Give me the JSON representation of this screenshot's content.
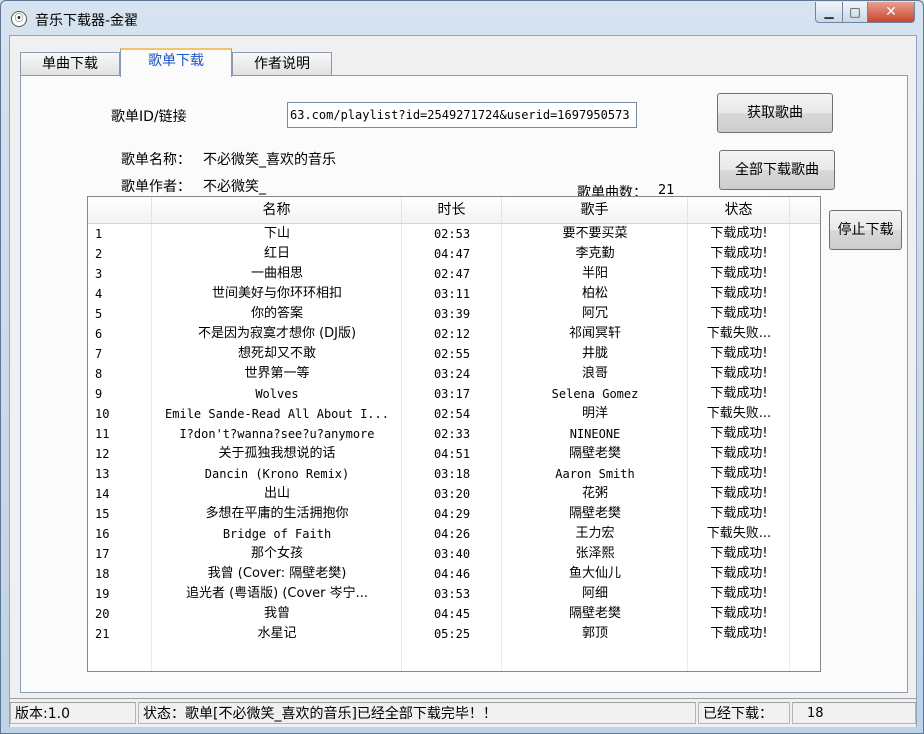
{
  "window": {
    "title": "音乐下载器-金翟",
    "minimize_label": "▁",
    "maximize_label": "□",
    "close_label": "✕"
  },
  "tabs": [
    {
      "label": "单曲下载",
      "active": false
    },
    {
      "label": "歌单下载",
      "active": true
    },
    {
      "label": "作者说明",
      "active": false
    }
  ],
  "playlist": {
    "id_label": "歌单ID/链接",
    "id_value": "63.com/playlist?id=2549271724&userid=1697950573",
    "fetch_button": "获取歌曲",
    "name_label": "歌单名称：",
    "name_value": "不必微笑_喜欢的音乐",
    "author_label": "歌单作者：",
    "author_value": "不必微笑_",
    "download_all_button": "全部下载歌曲",
    "count_label": "歌单曲数：",
    "count_value": "21",
    "stop_button": "停止下载"
  },
  "table": {
    "columns": [
      "名称",
      "时长",
      "歌手",
      "状态"
    ],
    "rows": [
      [
        "1",
        "下山",
        "02:53",
        "要不要买菜",
        "下载成功!"
      ],
      [
        "2",
        "红日",
        "04:47",
        "李克勤",
        "下载成功!"
      ],
      [
        "3",
        "一曲相思",
        "02:47",
        "半阳",
        "下载成功!"
      ],
      [
        "4",
        "世间美好与你环环相扣",
        "03:11",
        "柏松",
        "下载成功!"
      ],
      [
        "5",
        "你的答案",
        "03:39",
        "阿冗",
        "下载成功!"
      ],
      [
        "6",
        "不是因为寂寞才想你 (DJ版)",
        "02:12",
        "祁闻冥轩",
        "下载失败..."
      ],
      [
        "7",
        "想死却又不敢",
        "02:55",
        "井胧",
        "下载成功!"
      ],
      [
        "8",
        "世界第一等",
        "03:24",
        "浪哥",
        "下载成功!"
      ],
      [
        "9",
        "Wolves",
        "03:17",
        "Selena Gomez",
        "下载成功!"
      ],
      [
        "10",
        "Emile Sande-Read All About I...",
        "02:54",
        "明洋",
        "下载失败..."
      ],
      [
        "11",
        "I?don't?wanna?see?u?anymore",
        "02:33",
        "NINEONE",
        "下载成功!"
      ],
      [
        "12",
        "关于孤独我想说的话",
        "04:51",
        "隔壁老樊",
        "下载成功!"
      ],
      [
        "13",
        "Dancin (Krono Remix)",
        "03:18",
        "Aaron Smith",
        "下载成功!"
      ],
      [
        "14",
        "出山",
        "03:20",
        "花粥",
        "下载成功!"
      ],
      [
        "15",
        "多想在平庸的生活拥抱你",
        "04:29",
        "隔壁老樊",
        "下载成功!"
      ],
      [
        "16",
        "Bridge of Faith",
        "04:26",
        "王力宏",
        "下载失败..."
      ],
      [
        "17",
        "那个女孩",
        "03:40",
        "张泽熙",
        "下载成功!"
      ],
      [
        "18",
        "我曾 (Cover: 隔壁老樊)",
        "04:46",
        "鱼大仙儿",
        "下载成功!"
      ],
      [
        "19",
        "追光者 (粤语版) (Cover 岑宁...",
        "03:53",
        "阿细",
        "下载成功!"
      ],
      [
        "20",
        "我曾",
        "04:45",
        "隔壁老樊",
        "下载成功!"
      ],
      [
        "21",
        "水星记",
        "05:25",
        "郭顶",
        "下载成功!"
      ]
    ]
  },
  "statusbar": {
    "version": "版本:1.0",
    "status": "状态：歌单[不必微笑_喜欢的音乐]已经全部下载完毕！！",
    "downloaded_label": "已经下载：",
    "downloaded_value": "18"
  },
  "colors": {
    "active_tab_text": "#1a54c8",
    "active_tab_accent": "#f3c46a",
    "close_button": "#c8452c"
  }
}
